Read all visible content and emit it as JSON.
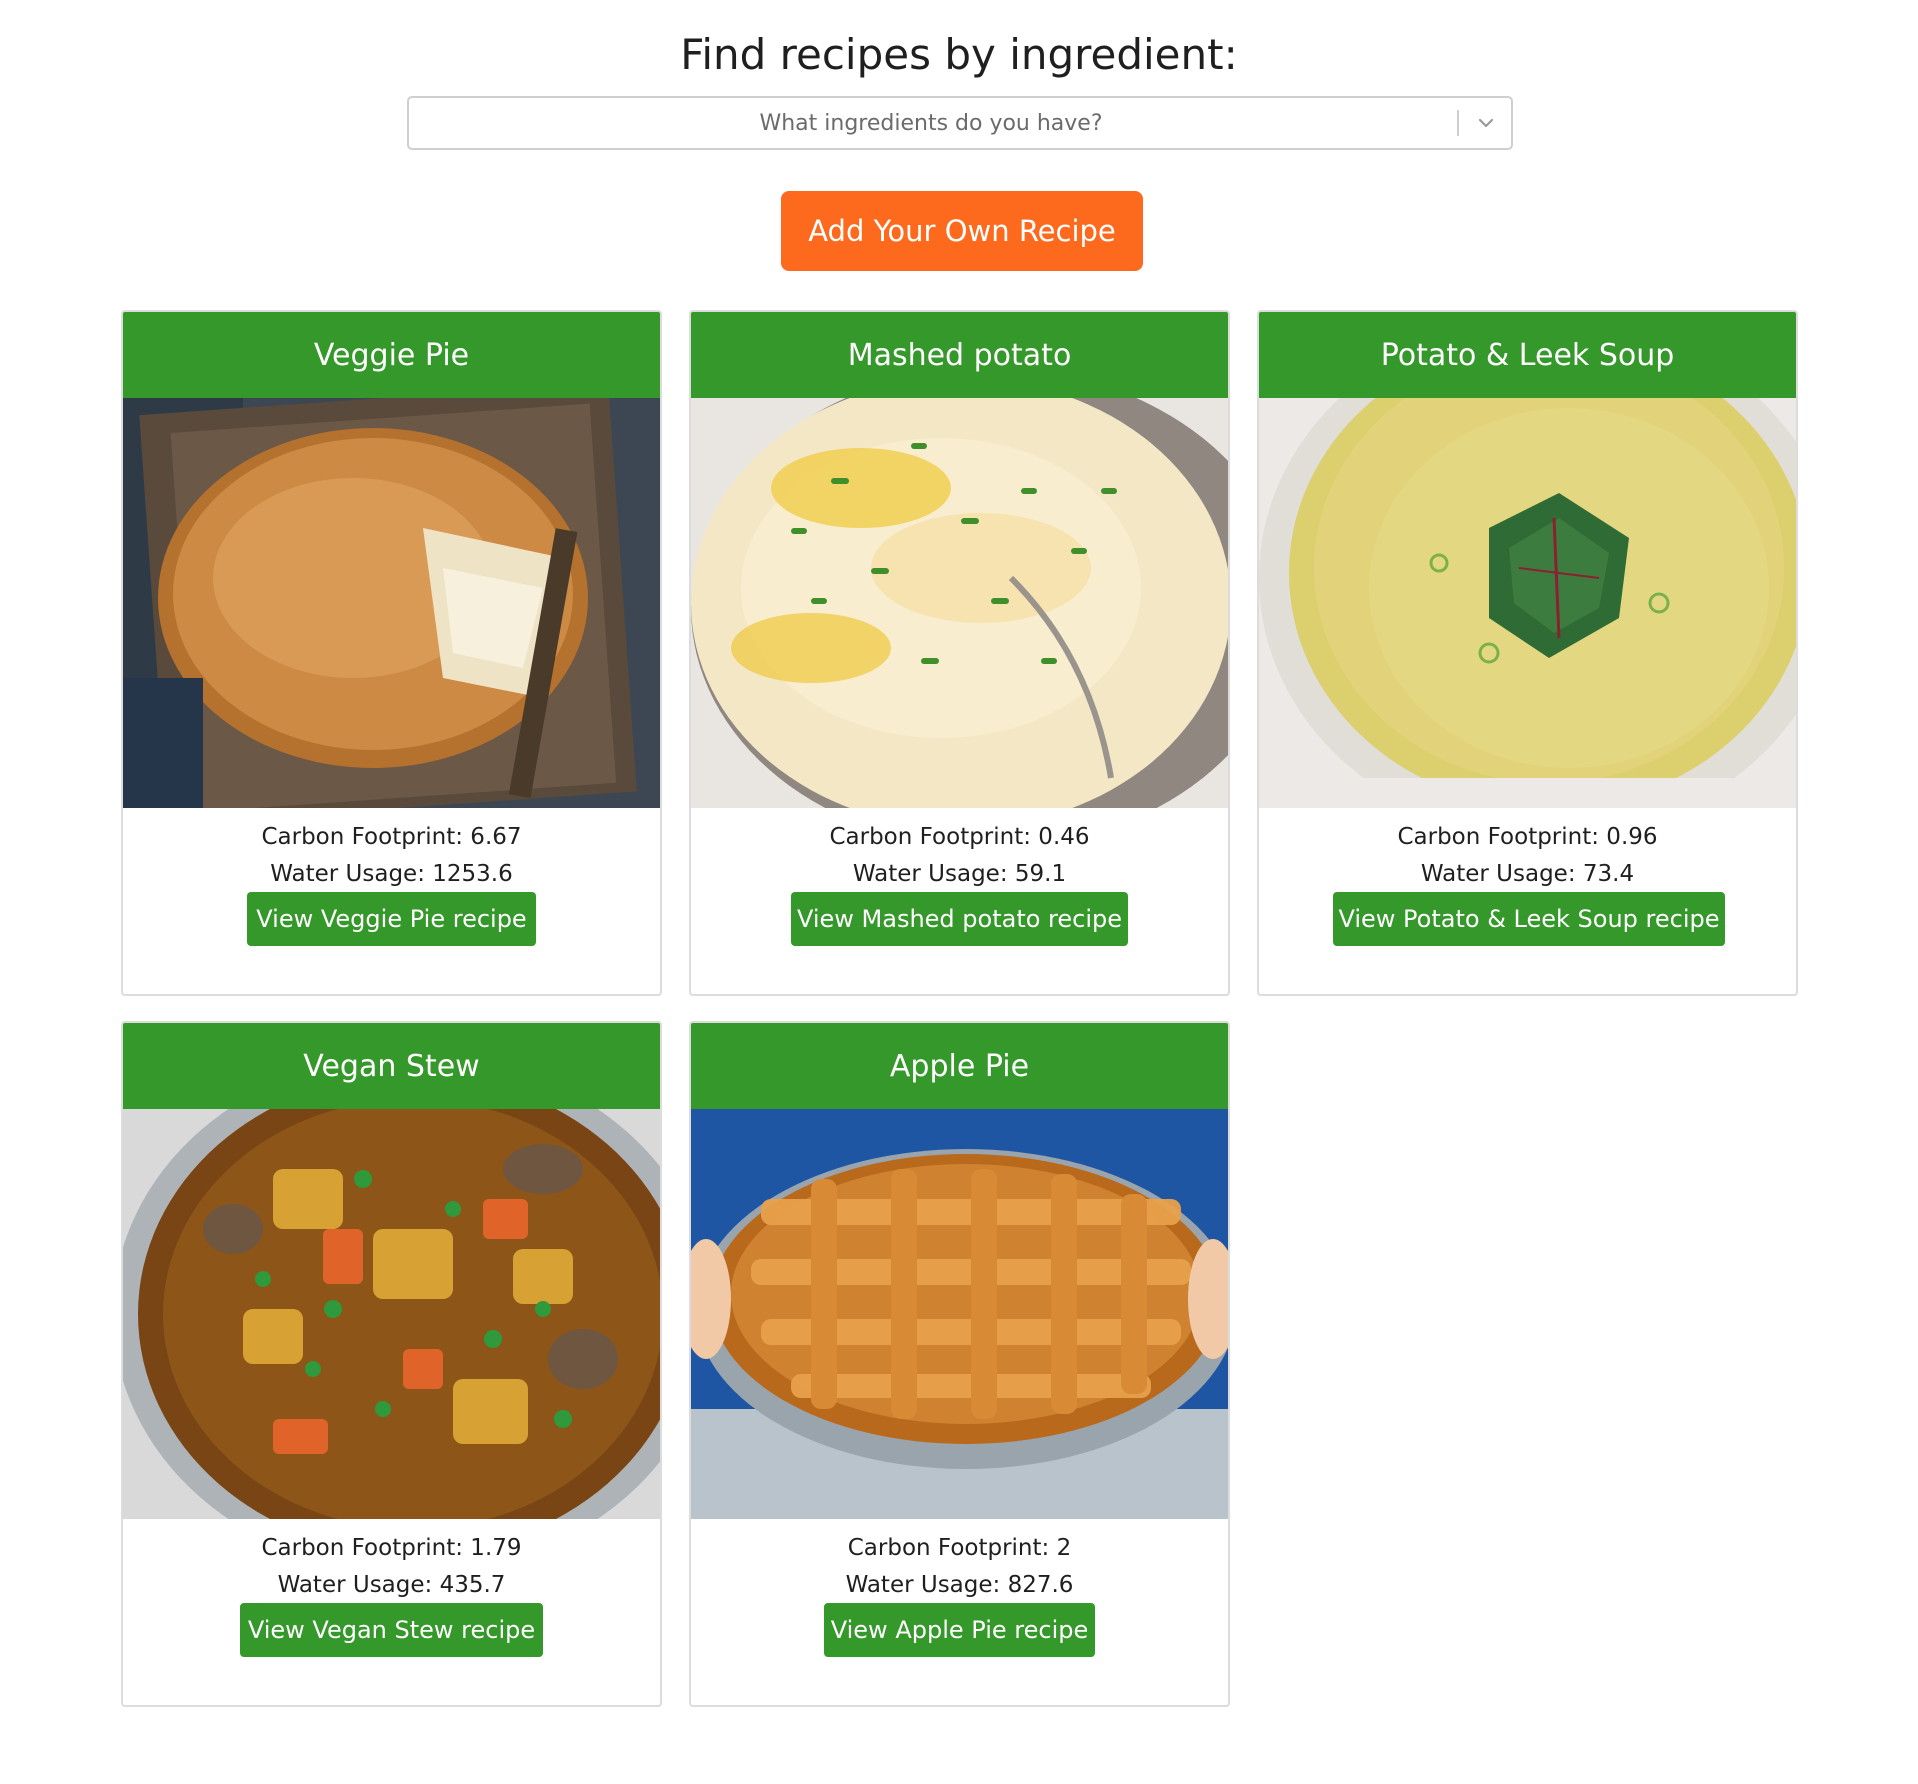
{
  "header": {
    "title": "Find recipes by ingredient:"
  },
  "search": {
    "placeholder": "What ingredients do you have?",
    "dropdown_icon": "chevron-down-icon"
  },
  "actions": {
    "add_recipe_label": "Add Your Own Recipe"
  },
  "colors": {
    "accent_orange": "#fd6a1e",
    "card_green": "#35982a",
    "text_dark": "#1f1f1f"
  },
  "recipes": [
    {
      "title": "Veggie Pie",
      "image": "veggie pie on wooden board",
      "carbon": "Carbon Footprint: 6.67",
      "water": "Water Usage: 1253.6",
      "button": "View Veggie Pie recipe"
    },
    {
      "title": "Mashed potato",
      "image": "mashed potato with chives in bowl",
      "carbon": "Carbon Footprint: 0.46",
      "water": "Water Usage: 59.1",
      "button": "View Mashed potato recipe"
    },
    {
      "title": "Potato & Leek Soup",
      "image": "potato and leek soup with greens",
      "carbon": "Carbon Footprint: 0.96",
      "water": "Water Usage: 73.4",
      "button": "View Potato & Leek Soup recipe"
    },
    {
      "title": "Vegan Stew",
      "image": "vegan stew with vegetables",
      "carbon": "Carbon Footprint: 1.79",
      "water": "Water Usage: 435.7",
      "button": "View Vegan Stew recipe"
    },
    {
      "title": "Apple Pie",
      "image": "lattice apple pie held in dish",
      "carbon": "Carbon Footprint: 2",
      "water": "Water Usage: 827.6",
      "button": "View Apple Pie recipe"
    }
  ]
}
